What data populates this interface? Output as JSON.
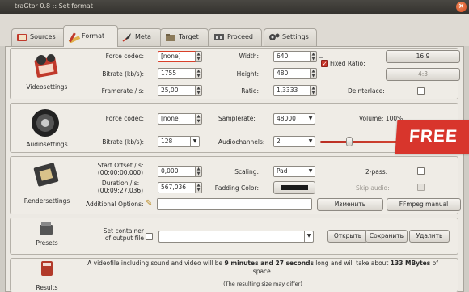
{
  "window": {
    "title": "traGtor 0.8 :: Set format"
  },
  "tabs": [
    {
      "label": "Sources",
      "icon": "book-icon"
    },
    {
      "label": "Format",
      "icon": "pencil-ruler-icon"
    },
    {
      "label": "Meta",
      "icon": "quill-icon"
    },
    {
      "label": "Target",
      "icon": "folder-icon"
    },
    {
      "label": "Proceed",
      "icon": "filmstrip-icon"
    },
    {
      "label": "Settings",
      "icon": "gears-icon"
    }
  ],
  "video": {
    "section_label": "Videosettings",
    "force_codec_label": "Force codec:",
    "force_codec_value": "[none]",
    "bitrate_label": "Bitrate (kb/s):",
    "bitrate_value": "1755",
    "framerate_label": "Framerate / s:",
    "framerate_value": "25,00",
    "width_label": "Width:",
    "width_value": "640",
    "height_label": "Height:",
    "height_value": "480",
    "ratio_label": "Ratio:",
    "ratio_value": "1,3333",
    "fixed_ratio_label": "Fixed Ratio:",
    "fixed_ratio_checked": true,
    "deinterlace_label": "Deinterlace:",
    "ratio_btn_1": "16:9",
    "ratio_btn_2": "4:3"
  },
  "audio": {
    "section_label": "Audiosettings",
    "force_codec_label": "Force codec:",
    "force_codec_value": "[none]",
    "bitrate_label": "Bitrate (kb/s):",
    "bitrate_value": "128",
    "samplerate_label": "Samplerate:",
    "samplerate_value": "48000",
    "channels_label": "Audiochannels:",
    "channels_value": "2",
    "volume_label": "Volume: 100%",
    "volume_level": 0.3
  },
  "banner": {
    "text": "FREE"
  },
  "render": {
    "section_label": "Rendersettings",
    "start_offset_label": "Start Offset / s:",
    "start_offset_sub": "(00:00:00.000)",
    "start_offset_value": "0,000",
    "duration_label": "Duration / s:",
    "duration_sub": "(00:09:27.036)",
    "duration_value": "567,036",
    "scaling_label": "Scaling:",
    "scaling_value": "Pad",
    "padding_color_label": "Padding Color:",
    "padding_color": "#1a1a1a",
    "twopass_label": "2-pass:",
    "skip_audio_label": "Skip audio:",
    "additional_label": "Additional Options:",
    "change_btn": "Изменить",
    "ffmpeg_btn": "FFmpeg manual"
  },
  "presets": {
    "section_label": "Presets",
    "container_label_1": "Set container",
    "container_label_2": "of output file",
    "open_btn": "Открыть",
    "save_btn": "Сохранить",
    "delete_btn": "Удалить"
  },
  "results": {
    "section_label": "Results",
    "summary_pre": "A videofile including sound and video will be ",
    "summary_duration": "9 minutes and 27 seconds",
    "summary_mid": " long and will take about ",
    "summary_size": "133 MBytes",
    "summary_post": " of",
    "summary_line2": "space.",
    "note": "(The resulting size may differ)"
  }
}
